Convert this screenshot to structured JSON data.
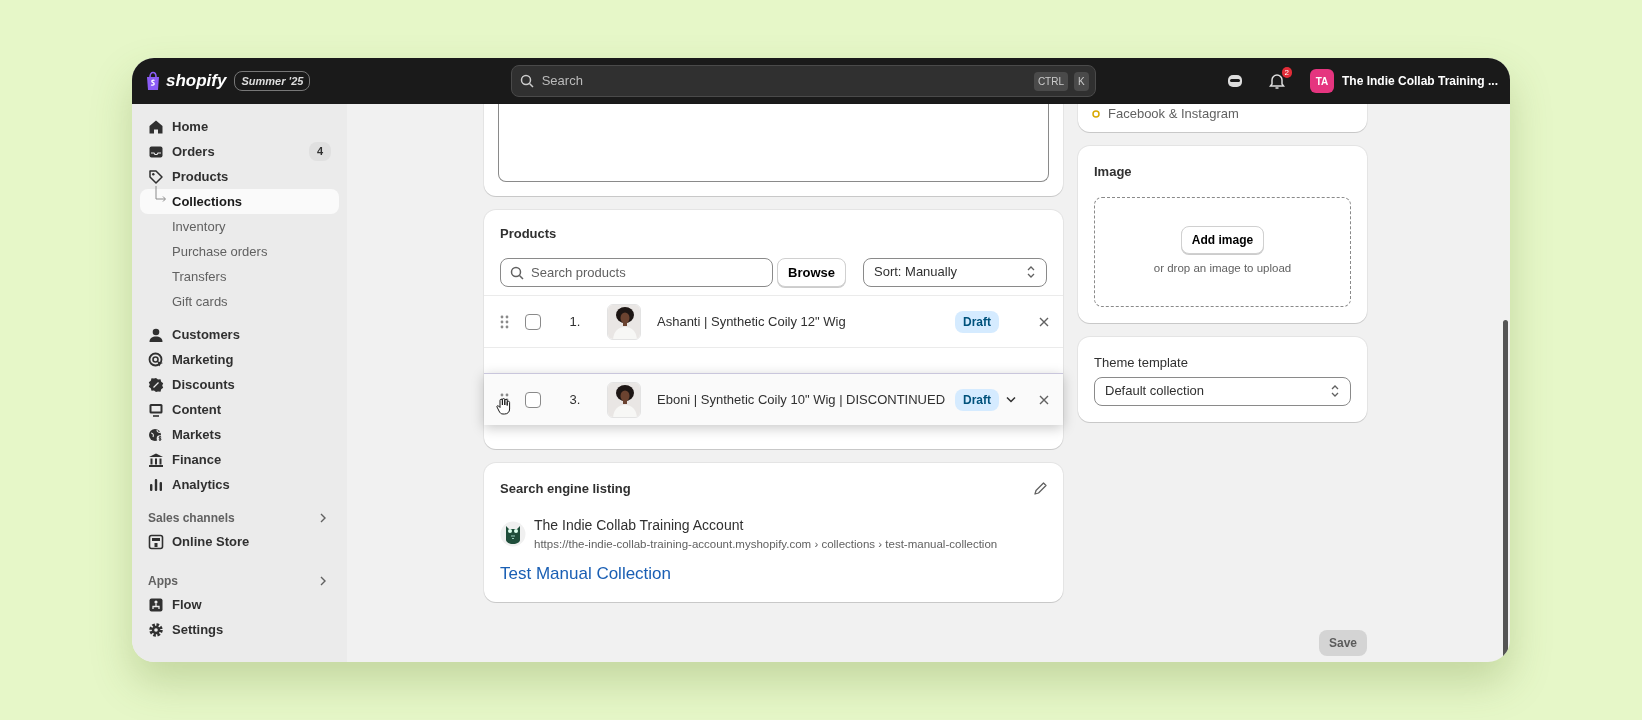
{
  "topbar": {
    "logo": "shopify",
    "edition": "Summer '25",
    "search": {
      "placeholder": "Search"
    },
    "shortcut_keys": [
      "CTRL",
      "K"
    ],
    "notification_count": "2",
    "avatar": "TA",
    "store": "The Indie Collab Training ..."
  },
  "sidebar": {
    "items": [
      {
        "label": "Home",
        "selected": false
      },
      {
        "label": "Orders",
        "selected": false,
        "badge": "4"
      },
      {
        "label": "Products",
        "selected": false,
        "children": [
          {
            "label": "Collections",
            "selected": true
          },
          {
            "label": "Inventory",
            "selected": false
          },
          {
            "label": "Purchase orders",
            "selected": false
          },
          {
            "label": "Transfers",
            "selected": false
          },
          {
            "label": "Gift cards",
            "selected": false
          }
        ]
      },
      {
        "label": "Customers",
        "selected": false
      },
      {
        "label": "Marketing",
        "selected": false
      },
      {
        "label": "Discounts",
        "selected": false
      },
      {
        "label": "Content",
        "selected": false
      },
      {
        "label": "Markets",
        "selected": false
      },
      {
        "label": "Finance",
        "selected": false
      },
      {
        "label": "Analytics",
        "selected": false
      }
    ],
    "sections": [
      {
        "title": "Sales channels",
        "items": [
          {
            "label": "Online Store",
            "selected": false
          }
        ]
      },
      {
        "title": "Apps",
        "items": [
          {
            "label": "Flow",
            "selected": false
          }
        ]
      }
    ],
    "footer_items": [
      {
        "label": "Settings",
        "selected": false
      }
    ]
  },
  "products": {
    "title": "Products",
    "search": {
      "placeholder": "Search products"
    },
    "browse": "Browse",
    "sort": "Sort: Manually",
    "rows": [
      {
        "number": "1.",
        "title": "Ashanti | Synthetic Coily 12\" Wig",
        "status": "Draft",
        "checked": false,
        "dragging": false
      },
      {
        "number": "3.",
        "title": "Eboni | Synthetic Coily 10\" Wig | DISCONTINUED",
        "status": "Draft",
        "checked": false,
        "dragging": true
      }
    ]
  },
  "seo": {
    "title": "Search engine listing",
    "site": "The Indie Collab Training Account",
    "url": "https://the-indie-collab-training-account.myshopify.com › collections › test-manual-collection",
    "page_title": "Test Manual Collection"
  },
  "channels": {
    "items": [
      "Facebook & Instagram"
    ]
  },
  "image_card": {
    "title": "Image",
    "button": "Add image",
    "hint": "or drop an image to upload"
  },
  "theme_template": {
    "label": "Theme template",
    "value": "Default collection"
  },
  "save_button": {
    "label": "Save",
    "disabled": true
  }
}
